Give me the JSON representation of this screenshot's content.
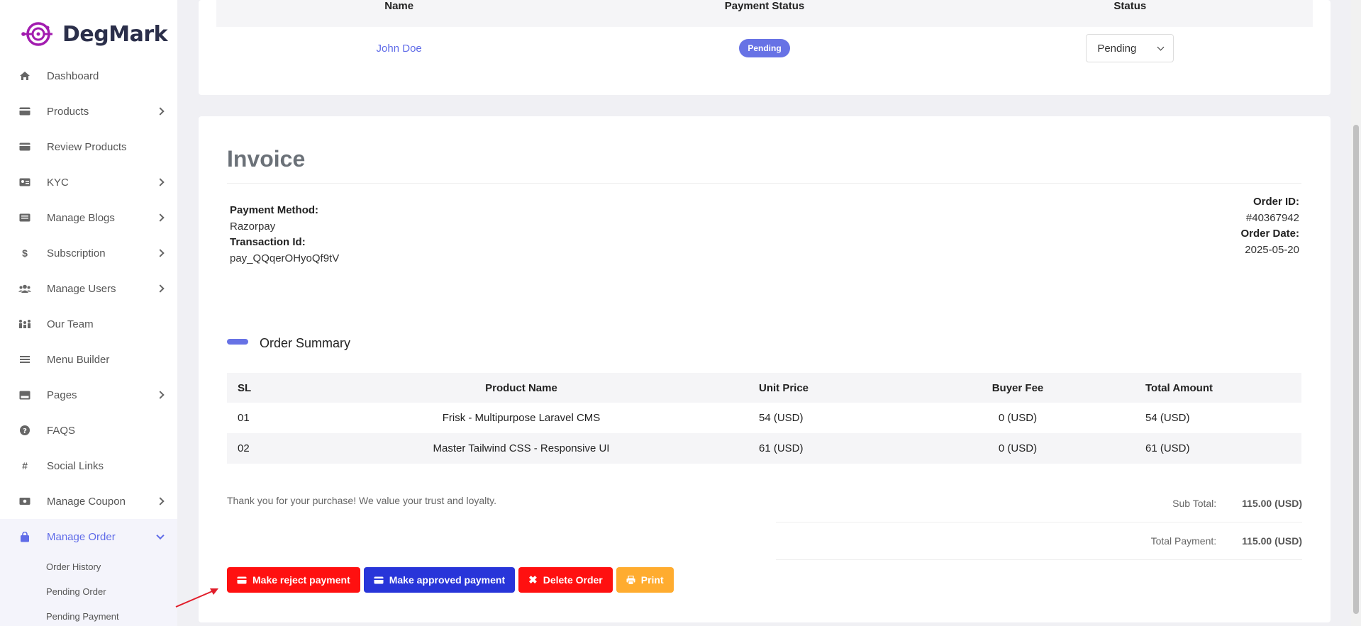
{
  "brand": {
    "name": "DegMark"
  },
  "sidebar": {
    "items": [
      {
        "label": "Dashboard",
        "icon": "home-icon",
        "chevron": false
      },
      {
        "label": "Products",
        "icon": "card-icon",
        "chevron": true
      },
      {
        "label": "Review Products",
        "icon": "card-icon",
        "chevron": false
      },
      {
        "label": "KYC",
        "icon": "id-card-icon",
        "chevron": true
      },
      {
        "label": "Manage Blogs",
        "icon": "blog-icon",
        "chevron": true
      },
      {
        "label": "Subscription",
        "icon": "dollar-icon",
        "chevron": true
      },
      {
        "label": "Manage Users",
        "icon": "users-icon",
        "chevron": true
      },
      {
        "label": "Our Team",
        "icon": "team-icon",
        "chevron": false
      },
      {
        "label": "Menu Builder",
        "icon": "menu-icon",
        "chevron": false
      },
      {
        "label": "Pages",
        "icon": "pages-icon",
        "chevron": true
      },
      {
        "label": "FAQS",
        "icon": "question-icon",
        "chevron": false
      },
      {
        "label": "Social Links",
        "icon": "hash-icon",
        "chevron": false
      },
      {
        "label": "Manage Coupon",
        "icon": "coupon-icon",
        "chevron": true
      },
      {
        "label": "Manage Order",
        "icon": "bag-icon",
        "chevron": true,
        "active": true
      }
    ],
    "sub_items": [
      "Order History",
      "Pending Order",
      "Pending Payment"
    ]
  },
  "order_table": {
    "headers": [
      "Name",
      "Payment Status",
      "Status"
    ],
    "row": {
      "name": "John Doe",
      "payment_status": "Pending",
      "status": "Pending"
    }
  },
  "invoice": {
    "title": "Invoice",
    "payment_method_label": "Payment Method:",
    "payment_method": "Razorpay",
    "transaction_label": "Transaction Id:",
    "transaction_id": "pay_QQqerOHyoQf9tV",
    "order_id_label": "Order ID:",
    "order_id": "#40367942",
    "order_date_label": "Order Date:",
    "order_date": "2025-05-20",
    "summary_title": "Order Summary",
    "items_headers": [
      "SL",
      "Product Name",
      "Unit Price",
      "Buyer Fee",
      "Total Amount"
    ],
    "items": [
      {
        "sl": "01",
        "name": "Frisk - Multipurpose Laravel CMS",
        "unit": "54 (USD)",
        "fee": "0 (USD)",
        "total": "54 (USD)"
      },
      {
        "sl": "02",
        "name": "Master Tailwind CSS - Responsive UI",
        "unit": "61 (USD)",
        "fee": "0 (USD)",
        "total": "61 (USD)"
      }
    ],
    "thanks": "Thank you for your purchase! We value your trust and loyalty.",
    "sub_total_label": "Sub Total:",
    "sub_total": "115.00 (USD)",
    "total_label": "Total Payment:",
    "total": "115.00 (USD)"
  },
  "actions": {
    "reject": "Make reject payment",
    "approve": "Make approved payment",
    "delete": "Delete Order",
    "print": "Print"
  },
  "colors": {
    "accent": "#5f6be8",
    "reject": "#ff1010",
    "approve": "#2835d9",
    "print": "#ffac2f"
  }
}
